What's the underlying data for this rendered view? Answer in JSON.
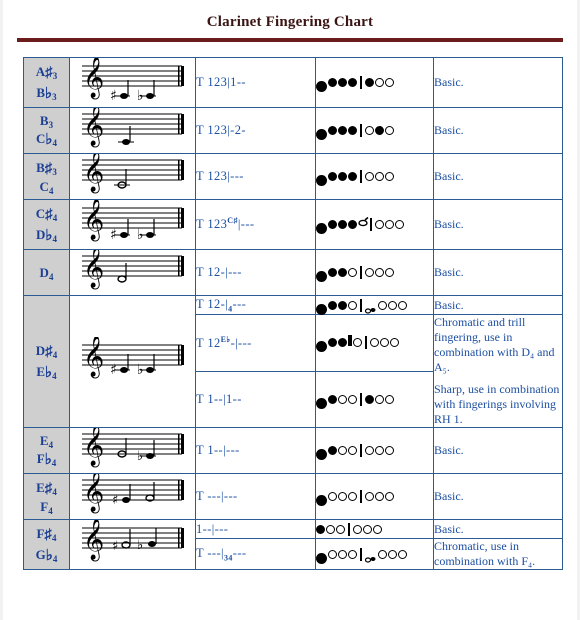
{
  "header": {
    "title": "Clarinet Fingering Chart",
    "rule_color": "#6b1d1d",
    "title_color": "#3b1414"
  },
  "theme": {
    "note_cell_bg": "#cfcfcf",
    "text_blue": "#1c4fa0",
    "border_blue": "#2c5b94"
  },
  "rows": [
    {
      "note": {
        "primary": "A",
        "primary_accidental": "♯",
        "primary_octave": "3",
        "secondary": "B",
        "secondary_accidental": "♭",
        "secondary_octave": "3"
      },
      "entries": [
        {
          "fingering": "T 123|1--",
          "comment": "Basic."
        }
      ]
    },
    {
      "note": {
        "primary": "B",
        "primary_accidental": "",
        "primary_octave": "3",
        "secondary": "C",
        "secondary_accidental": "♭",
        "secondary_octave": "4"
      },
      "entries": [
        {
          "fingering": "T 123|-2-",
          "comment": "Basic."
        }
      ]
    },
    {
      "note": {
        "primary": "B",
        "primary_accidental": "♯",
        "primary_octave": "3",
        "secondary": "C",
        "secondary_accidental": "",
        "secondary_octave": "4"
      },
      "entries": [
        {
          "fingering": "T 123|---",
          "comment": "Basic."
        }
      ]
    },
    {
      "note": {
        "primary": "C",
        "primary_accidental": "♯",
        "primary_octave": "4",
        "secondary": "D",
        "secondary_accidental": "♭",
        "secondary_octave": "4"
      },
      "entries": [
        {
          "fingering_pre": "T 123",
          "fingering_sup": "C♯",
          "fingering_post": "|---",
          "comment": "Basic."
        }
      ]
    },
    {
      "note": {
        "primary": "D",
        "primary_accidental": "",
        "primary_octave": "4",
        "secondary": "",
        "secondary_accidental": "",
        "secondary_octave": ""
      },
      "entries": [
        {
          "fingering": "T 12-|---",
          "comment": "Basic."
        }
      ]
    },
    {
      "note": {
        "primary": "D",
        "primary_accidental": "♯",
        "primary_octave": "4",
        "secondary": "E",
        "secondary_accidental": "♭",
        "secondary_octave": "4"
      },
      "entries": [
        {
          "fingering_pre": "T 12-|",
          "fingering_sub": "4",
          "fingering_post": "---",
          "comment": "Basic."
        },
        {
          "fingering_pre": "T 12",
          "fingering_sup": "E♭",
          "fingering_post": "-|---",
          "comment_paras": [
            "Chromatic and trill fingering, use in combination with D₄ and A₅.",
            "Sharp, use in combination with fingerings involving RH 1."
          ]
        },
        {
          "fingering": "T 1--|1--",
          "comment": ""
        }
      ]
    },
    {
      "note": {
        "primary": "E",
        "primary_accidental": "",
        "primary_octave": "4",
        "secondary": "F",
        "secondary_accidental": "♭",
        "secondary_octave": "4"
      },
      "entries": [
        {
          "fingering": "T 1--|---",
          "comment": "Basic."
        }
      ]
    },
    {
      "note": {
        "primary": "E",
        "primary_accidental": "♯",
        "primary_octave": "4",
        "secondary": "F",
        "secondary_accidental": "",
        "secondary_octave": "4"
      },
      "entries": [
        {
          "fingering": "T ---|---",
          "comment": "Basic."
        }
      ]
    },
    {
      "note": {
        "primary": "F",
        "primary_accidental": "♯",
        "primary_octave": "4",
        "secondary": "G",
        "secondary_accidental": "♭",
        "secondary_octave": "4"
      },
      "entries": [
        {
          "fingering": "1--|---",
          "comment": "Basic."
        },
        {
          "fingering_pre": "T ---|",
          "fingering_sub": "34",
          "fingering_post": "---",
          "comment_paras": [
            "Chromatic, use in combination with F₄."
          ]
        }
      ]
    }
  ],
  "labels": {
    "basic": "Basic.",
    "staff_alt": "treble clef staff with notes"
  }
}
